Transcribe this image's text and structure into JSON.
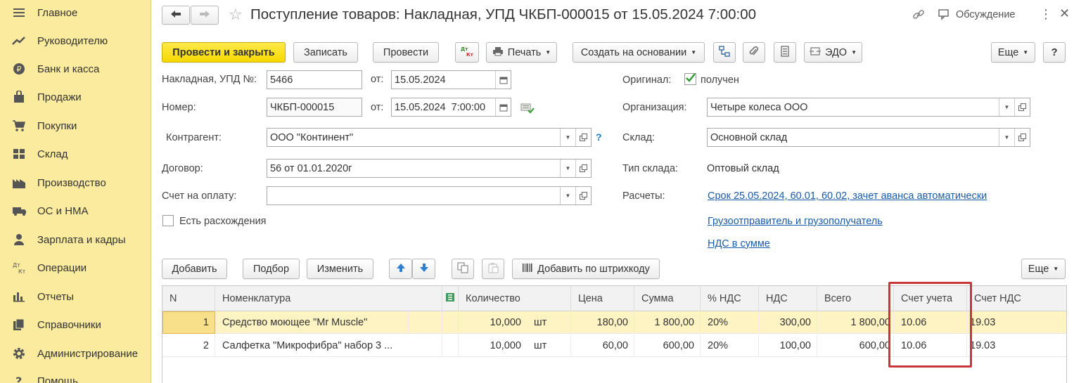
{
  "sidebar": {
    "items": [
      {
        "label": "Главное",
        "icon": "menu-icon"
      },
      {
        "label": "Руководителю",
        "icon": "trend-icon"
      },
      {
        "label": "Банк и касса",
        "icon": "ruble-icon"
      },
      {
        "label": "Продажи",
        "icon": "bag-icon"
      },
      {
        "label": "Покупки",
        "icon": "cart-icon"
      },
      {
        "label": "Склад",
        "icon": "warehouse-icon"
      },
      {
        "label": "Производство",
        "icon": "factory-icon"
      },
      {
        "label": "ОС и НМА",
        "icon": "truck-icon"
      },
      {
        "label": "Зарплата и кадры",
        "icon": "person-icon"
      },
      {
        "label": "Операции",
        "icon": "dt-kt-icon"
      },
      {
        "label": "Отчеты",
        "icon": "bar-chart-icon"
      },
      {
        "label": "Справочники",
        "icon": "books-icon"
      },
      {
        "label": "Администрирование",
        "icon": "gear-icon"
      },
      {
        "label": "Помощь",
        "icon": "help-icon"
      }
    ]
  },
  "header": {
    "title": "Поступление товаров: Накладная, УПД ЧКБП-000015 от 15.05.2024 7:00:00",
    "discussion": "Обсуждение"
  },
  "toolbar": {
    "post_close": "Провести и закрыть",
    "save": "Записать",
    "post": "Провести",
    "dtkt": "Дт Кт",
    "print": "Печать",
    "create_based": "Создать на основании",
    "edo": "ЭДО",
    "more": "Еще",
    "help": "?"
  },
  "form": {
    "invoice_label": "Накладная, УПД №:",
    "invoice_value": "5466",
    "from_label": "от:",
    "invoice_date": "15.05.2024",
    "number_label": "Номер:",
    "number_value": "ЧКБП-000015",
    "number_date": "15.05.2024  7:00:00",
    "counterparty_label": "Контрагент:",
    "counterparty_value": "ООО \"Континент\"",
    "contract_label": "Договор:",
    "contract_value": "56 от 01.01.2020г",
    "invoice_pay_label": "Счет на оплату:",
    "invoice_pay_value": "",
    "discrepancy_label": "Есть расхождения",
    "original_label": "Оригинал:",
    "original_value": "получен",
    "org_label": "Организация:",
    "org_value": "Четыре колеса ООО",
    "warehouse_label": "Склад:",
    "warehouse_value": "Основной склад",
    "wh_type_label": "Тип склада:",
    "wh_type_value": "Оптовый склад",
    "settlements_label": "Расчеты:",
    "settlements_link": "Срок 25.05.2024, 60.01, 60.02, зачет аванса автоматически",
    "shipper_link": "Грузоотправитель и грузополучатель",
    "vat_link": "НДС в сумме"
  },
  "table_toolbar": {
    "add": "Добавить",
    "select": "Подбор",
    "edit": "Изменить",
    "barcode": "Добавить по штрихкоду",
    "more": "Еще"
  },
  "table": {
    "columns": [
      "N",
      "Номенклатура",
      "Количество",
      "Цена",
      "Сумма",
      "% НДС",
      "НДС",
      "Всего",
      "Счет учета",
      "Счет НДС"
    ],
    "rows": [
      {
        "n": "1",
        "name": "Средство моющее \"Mr Muscle\"",
        "qty": "10,000",
        "unit": "шт",
        "price": "180,00",
        "sum": "1 800,00",
        "vat_rate": "20%",
        "vat": "300,00",
        "total": "1 800,00",
        "account": "10.06",
        "vat_account": "19.03"
      },
      {
        "n": "2",
        "name": "Салфетка \"Микрофибра\" набор 3 ...",
        "qty": "10,000",
        "unit": "шт",
        "price": "60,00",
        "sum": "600,00",
        "vat_rate": "20%",
        "vat": "100,00",
        "total": "600,00",
        "account": "10.06",
        "vat_account": "19.03"
      }
    ]
  },
  "colors": {
    "sidebar_bg": "#fbeb9e",
    "primary_button": "#f5d900",
    "link": "#1a5ca9",
    "highlight": "#c7363b",
    "selected_row": "#fdf3c3"
  }
}
